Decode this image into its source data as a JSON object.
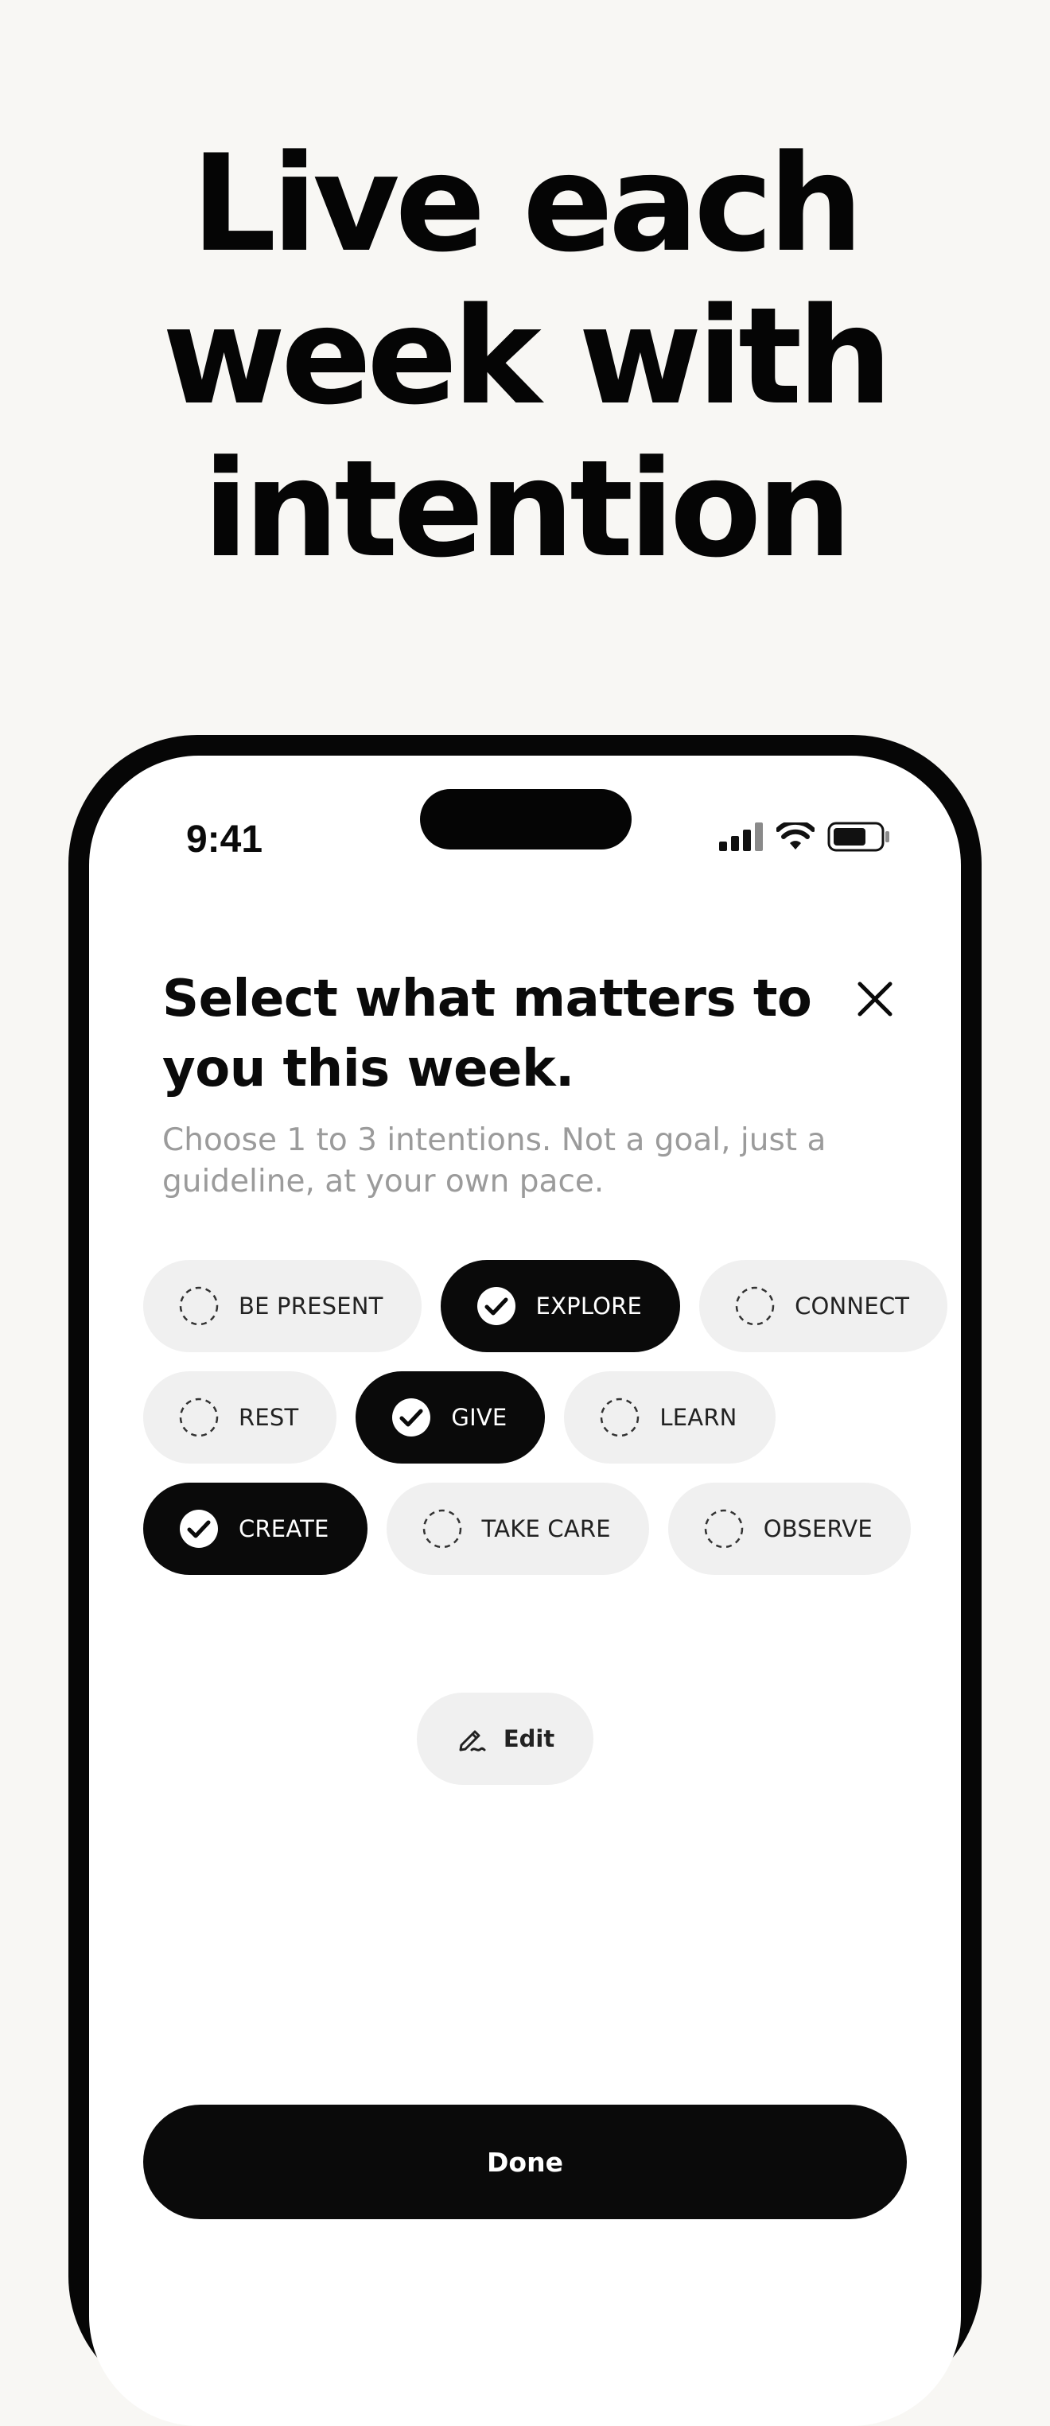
{
  "hero": {
    "line1": "Live each",
    "line2": "week with",
    "line3": "intention"
  },
  "status_bar": {
    "time": "9:41",
    "icons": [
      "cellular-signal-icon",
      "wifi-icon",
      "battery-icon"
    ]
  },
  "sheet": {
    "title": "Select what matters to you this week.",
    "subtitle": "Choose 1 to 3 intentions. Not a goal, just a guideline, at your own pace.",
    "close_icon": "close-icon"
  },
  "intentions": [
    {
      "label": "BE PRESENT",
      "selected": false
    },
    {
      "label": "EXPLORE",
      "selected": true
    },
    {
      "label": "CONNECT",
      "selected": false
    },
    {
      "label": "REST",
      "selected": false
    },
    {
      "label": "GIVE",
      "selected": true
    },
    {
      "label": "LEARN",
      "selected": false
    },
    {
      "label": "CREATE",
      "selected": true
    },
    {
      "label": "TAKE CARE",
      "selected": false
    },
    {
      "label": "OBSERVE",
      "selected": false
    }
  ],
  "edit": {
    "label": "Edit",
    "icon": "pencil-icon"
  },
  "done": {
    "label": "Done"
  },
  "colors": {
    "background": "#f8f7f4",
    "accent": "#0a0a0a",
    "chip_unselected": "#f0f0f0",
    "subtitle_gray": "#9b9b9b"
  }
}
